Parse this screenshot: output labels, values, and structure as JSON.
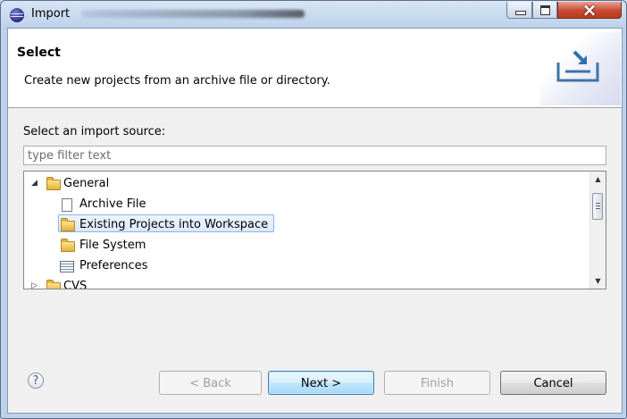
{
  "window": {
    "title": "Import"
  },
  "header": {
    "title": "Select",
    "description": "Create new projects from an archive file or directory."
  },
  "source": {
    "label": "Select an import source:",
    "filter_placeholder": "type filter text"
  },
  "tree": {
    "items": [
      {
        "label": "General",
        "expanded": true,
        "icon": "folder-open-icon"
      },
      {
        "label": "Archive File",
        "icon": "archive-file-icon"
      },
      {
        "label": "Existing Projects into Workspace",
        "icon": "project-folder-icon",
        "selected": true
      },
      {
        "label": "File System",
        "icon": "folder-icon"
      },
      {
        "label": "Preferences",
        "icon": "preferences-icon"
      },
      {
        "label": "CVS",
        "expanded": false,
        "icon": "folder-icon"
      }
    ]
  },
  "buttons": {
    "help": "?",
    "back": "< Back",
    "next": "Next >",
    "finish": "Finish",
    "cancel": "Cancel"
  },
  "colors": {
    "selection_border": "#8ab4e6",
    "default_button": "#a7d9f5"
  }
}
